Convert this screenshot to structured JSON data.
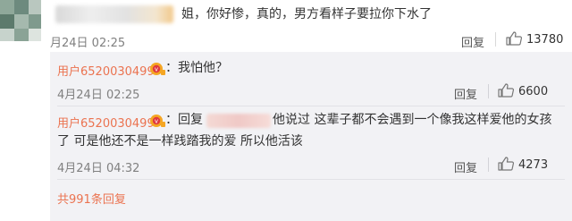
{
  "top_comment": {
    "text": "姐，你好惨，真的，男方看样子要拉你下水了",
    "date": "月24日 02:25",
    "reply_label": "回复",
    "likes": "13780"
  },
  "replies": [
    {
      "user": "用户6520030499",
      "text": "：我怕他？",
      "date": "4月24日 02:25",
      "reply_label": "回复",
      "likes": "6600"
    },
    {
      "user": "用户6520030499",
      "prefix": "：回复",
      "text_line1": "他说过 这辈子都不会遇到一个像我这样爱他的女孩",
      "text_line2": "了 可是他还不是一样践踏我的爱 所以他活该",
      "date": "4月24日 04:32",
      "reply_label": "回复",
      "likes": "4273"
    }
  ],
  "more_replies": "共991条回复",
  "colors": {
    "username": "#eb7350",
    "nested_bg": "#f2f2f5",
    "meta": "#808080"
  },
  "icons": {
    "like": "thumbs-up-icon",
    "vip": "vip-badge-icon"
  }
}
